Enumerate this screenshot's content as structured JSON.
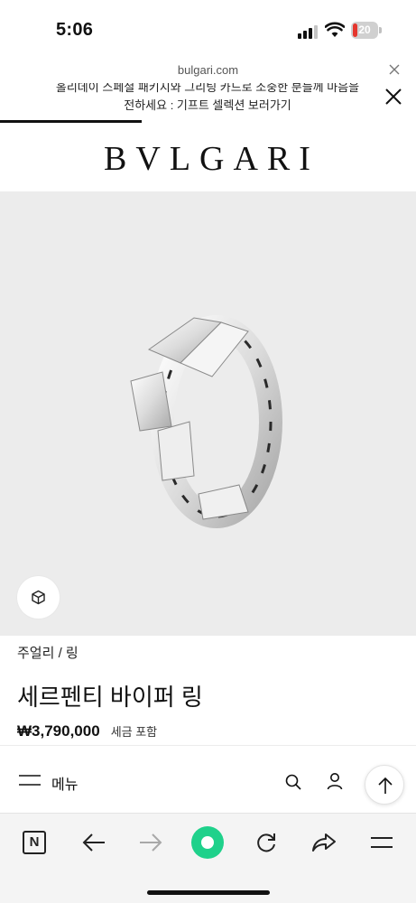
{
  "status_bar": {
    "time": "5:06",
    "battery_level": "20",
    "battery_color": "#e5362e",
    "icons": [
      "cellular-signal-icon",
      "wifi-icon",
      "battery-icon"
    ]
  },
  "url_bar": {
    "domain": "bulgari.com",
    "close_icon": "close-icon"
  },
  "promo_banner": {
    "line1": "홀리데이 스페셜 패키지와 그리팅 카드로 소중한 분들께 마음을",
    "line2": "전하세요 : 기프트 셀렉션 보러가기",
    "close_icon": "close-icon",
    "progress": 0.34
  },
  "header": {
    "logo": "BVLGARI"
  },
  "hero": {
    "image_description_icon": "ring-image",
    "ar_icon": "cube-3d-icon"
  },
  "product": {
    "breadcrumb": "주얼리 / 링",
    "title": "세르펜티 바이퍼 링",
    "price": "₩3,790,000",
    "tax_note": "세금 포함"
  },
  "site_nav": {
    "menu_label": "메뉴",
    "icons": [
      "hamburger-icon",
      "search-icon",
      "account-icon",
      "arrow-up-icon"
    ]
  },
  "browser_toolbar": {
    "tab_label": "N",
    "accent_color": "#1fd18b",
    "icons": [
      "tabs-icon",
      "back-arrow-icon",
      "forward-arrow-icon",
      "home-icon",
      "reload-icon",
      "share-icon",
      "menu-icon"
    ]
  }
}
